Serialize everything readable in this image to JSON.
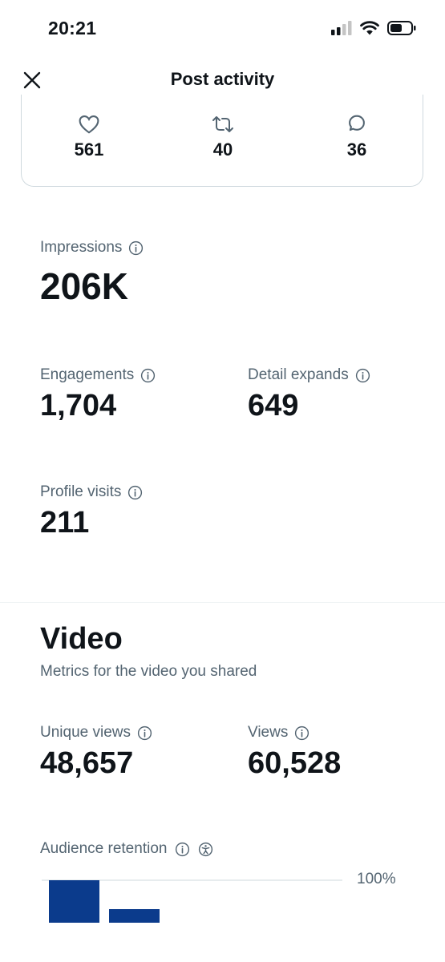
{
  "status_bar": {
    "time": "20:21"
  },
  "header": {
    "title": "Post activity"
  },
  "engagement_stats": {
    "likes": "561",
    "reposts": "40",
    "replies": "36"
  },
  "metrics": {
    "impressions": {
      "label": "Impressions",
      "value": "206K"
    },
    "engagements": {
      "label": "Engagements",
      "value": "1,704"
    },
    "detail_expands": {
      "label": "Detail expands",
      "value": "649"
    },
    "profile_visits": {
      "label": "Profile visits",
      "value": "211"
    }
  },
  "video": {
    "title": "Video",
    "subtitle": "Metrics for the video you shared",
    "unique_views": {
      "label": "Unique views",
      "value": "48,657"
    },
    "views": {
      "label": "Views",
      "value": "60,528"
    },
    "retention": {
      "label": "Audience retention",
      "max_label": "100%",
      "bar_color": "#0b3b8c",
      "bars": [
        100,
        32
      ]
    }
  },
  "icons": [
    "close-icon",
    "signal-icon",
    "wifi-icon",
    "battery-icon",
    "heart-icon",
    "repost-icon",
    "reply-icon",
    "info-icon",
    "accessibility-icon"
  ]
}
